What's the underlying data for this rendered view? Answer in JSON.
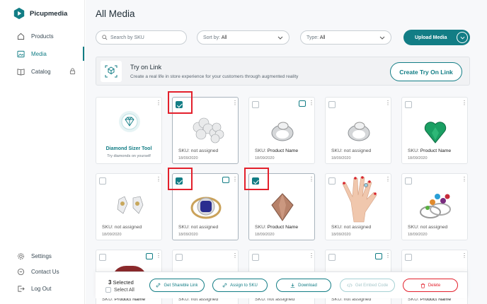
{
  "app": {
    "name": "Picupmedia"
  },
  "sidebar": {
    "items": [
      {
        "label": "Products"
      },
      {
        "label": "Media"
      },
      {
        "label": "Catalog"
      }
    ],
    "bottom": [
      {
        "label": "Settings"
      },
      {
        "label": "Contact Us"
      },
      {
        "label": "Log Out"
      }
    ]
  },
  "page": {
    "title": "All Media"
  },
  "toolbar": {
    "search_placeholder": "Search by SKU",
    "sort_label": "Sort by:",
    "sort_value": "All",
    "type_label": "Type:",
    "type_value": "All",
    "upload_label": "Upload Media"
  },
  "banner": {
    "title": "Try on Link",
    "subtitle": "Create a real life in store experience for your customers through augmented reality",
    "button": "Create Try On Link"
  },
  "cards": [
    {
      "sku_label": "SKU:",
      "sku": "not assigned",
      "date": "18/09/2020"
    },
    {
      "sku_label": "SKU:",
      "sku": "Product Name",
      "date": "18/09/2020"
    },
    {
      "sku_label": "SKU:",
      "sku": "not assigned",
      "date": "18/09/2020"
    },
    {
      "sku_label": "SKU:",
      "sku": "Product Name",
      "date": "18/09/2020"
    },
    {
      "sku_label": "SKU:",
      "sku": "not assigned",
      "date": "18/09/2020"
    },
    {
      "sku_label": "SKU:",
      "sku": "not assigned",
      "date": "18/09/2020"
    },
    {
      "sku_label": "SKU:",
      "sku": "Product Name",
      "date": "18/09/2020"
    },
    {
      "sku_label": "SKU:",
      "sku": "not assigned",
      "date": "18/09/2020"
    },
    {
      "sku_label": "SKU:",
      "sku": "not assigned",
      "date": "18/09/2020"
    },
    {
      "sku_label": "SKU:",
      "sku": "Product Name"
    },
    {
      "sku_label": "SKU:",
      "sku": "not assigned"
    },
    {
      "sku_label": "SKU:",
      "sku": "not assigned"
    },
    {
      "sku_label": "SKU:",
      "sku": "not assigned"
    },
    {
      "sku_label": "SKU:",
      "sku": "Product Name"
    }
  ],
  "diamond_tool": {
    "title": "Diamond Sizer Tool",
    "subtitle": "Try diamonds on yourself"
  },
  "actionbar": {
    "count": "3",
    "selected": "Selected",
    "select_all": "Select All",
    "share": "Get Shareble Link",
    "assign": "Assign to SKU",
    "download": "Download",
    "embed": "Get Embed Code",
    "delete": "Delete"
  },
  "colors": {
    "accent": "#127d85",
    "danger": "#e3202c",
    "selection_box": "#e3202c"
  }
}
